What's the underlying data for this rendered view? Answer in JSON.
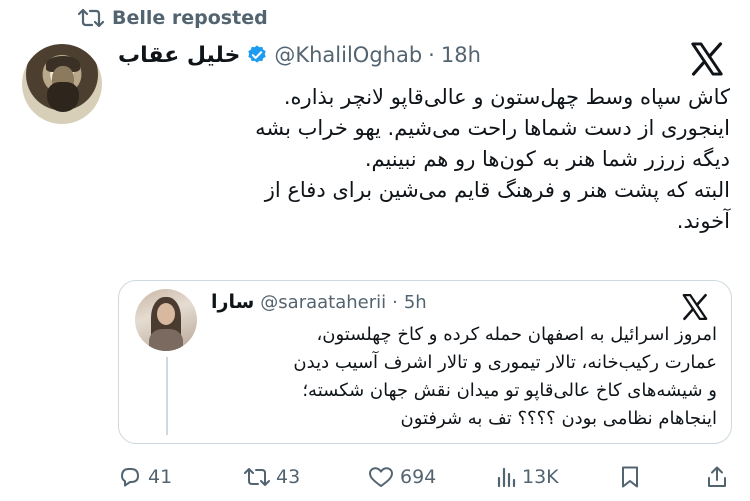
{
  "repost": {
    "label": "Belle reposted"
  },
  "tweet": {
    "author_name": "خلیل عقاب",
    "handle": "@KhalilOghab",
    "separator": "·",
    "time": "18h",
    "lines": [
      "کاش سپاه وسط چهل‌ستون و عالی‌قاپو لانچر بذاره.",
      "اینجوری از دست شماها راحت می‌شیم. یهو خراب بشه",
      "دیگه زرزر شما هنر به کون‌ها رو هم نبینیم.",
      "البته که پشت هنر و فرهنگ قایم می‌شین برای دفاع از",
      "آخوند."
    ]
  },
  "quote": {
    "author_name": "سارا",
    "handle": "@saraataherii",
    "separator": "·",
    "time": "5h",
    "lines": [
      "امروز اسرائیل به اصفهان حمله کرده و کاخ چهلستون،",
      "عمارت رکیب‌خانه، تالار تیموری و تالار اشرف آسیب دیدن",
      "و شیشه‌های کاخ عالی‌قاپو تو میدان نقش جهان شکسته؛",
      "اینجاهام نظامی بودن ؟؟؟؟ تف به شرفتون"
    ]
  },
  "actions": {
    "replies": "41",
    "reposts": "43",
    "likes": "694",
    "views": "13K"
  },
  "colors": {
    "text": "#0f1419",
    "muted": "#536471",
    "verified": "#1d9bf0",
    "border": "#cfd9de"
  }
}
